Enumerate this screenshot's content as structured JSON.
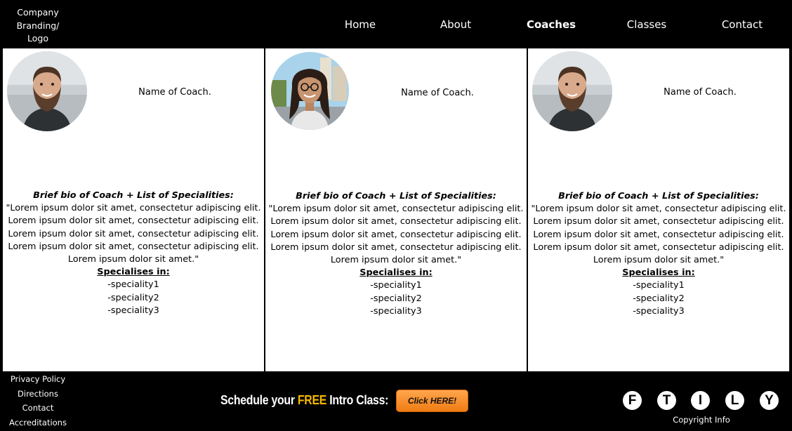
{
  "header": {
    "logo_lines": [
      "Company",
      "Branding/",
      "Logo"
    ],
    "nav": [
      {
        "label": "Home"
      },
      {
        "label": "About"
      },
      {
        "label": "Coaches",
        "active": true
      },
      {
        "label": "Classes"
      },
      {
        "label": "Contact"
      }
    ]
  },
  "coaches": [
    {
      "name": "Name of Coach.",
      "avatar_icon": "bearded-man-photo",
      "bio_title": "Brief bio of Coach + List of Specialities:",
      "bio_lines": [
        "\"Lorem ipsum dolor sit amet, consectetur adipiscing elit.",
        "Lorem ipsum dolor sit amet, consectetur adipiscing elit.",
        "Lorem ipsum dolor sit amet, consectetur adipiscing elit.",
        "Lorem ipsum dolor sit amet, consectetur adipiscing elit.",
        "Lorem ipsum dolor sit amet.\""
      ],
      "specialises_title": "Specialises in:",
      "specialities": [
        "-speciality1",
        "-speciality2",
        "-speciality3"
      ]
    },
    {
      "name": "Name of Coach.",
      "avatar_icon": "smiling-woman-photo",
      "bio_title": "Brief bio of Coach + List of Specialities:",
      "bio_lines": [
        "\"Lorem ipsum dolor sit amet, consectetur adipiscing elit.",
        "Lorem ipsum dolor sit amet, consectetur adipiscing elit.",
        "Lorem ipsum dolor sit amet, consectetur adipiscing elit.",
        "Lorem ipsum dolor sit amet, consectetur adipiscing elit.",
        "Lorem ipsum dolor sit amet.\""
      ],
      "specialises_title": "Specialises in:",
      "specialities": [
        "-speciality1",
        "-speciality2",
        "-speciality3"
      ]
    },
    {
      "name": "Name of Coach.",
      "avatar_icon": "bearded-man-photo",
      "bio_title": "Brief bio of Coach + List of Specialities:",
      "bio_lines": [
        "\"Lorem ipsum dolor sit amet, consectetur adipiscing elit.",
        "Lorem ipsum dolor sit amet, consectetur adipiscing elit.",
        "Lorem ipsum dolor sit amet, consectetur adipiscing elit.",
        "Lorem ipsum dolor sit amet, consectetur adipiscing elit.",
        "Lorem ipsum dolor sit amet.\""
      ],
      "specialises_title": "Specialises in:",
      "specialities": [
        "-speciality1",
        "-speciality2",
        "-speciality3"
      ]
    }
  ],
  "footer": {
    "links": [
      "Privacy Policy",
      "Directions",
      "Contact",
      "Accreditations"
    ],
    "cta_prefix": "Schedule your ",
    "cta_highlight": "FREE",
    "cta_suffix": " Intro Class:",
    "cta_button": "Click HERE!",
    "social": [
      {
        "letter": "F",
        "icon": "facebook-icon"
      },
      {
        "letter": "T",
        "icon": "twitter-icon"
      },
      {
        "letter": "I",
        "icon": "instagram-icon"
      },
      {
        "letter": "L",
        "icon": "linkedin-icon"
      },
      {
        "letter": "Y",
        "icon": "youtube-icon"
      }
    ],
    "copyright": "Copyright Info"
  },
  "colors": {
    "background": "#000000",
    "panel": "#ffffff",
    "highlight": "#f5b800",
    "button": "#f58a1f"
  }
}
